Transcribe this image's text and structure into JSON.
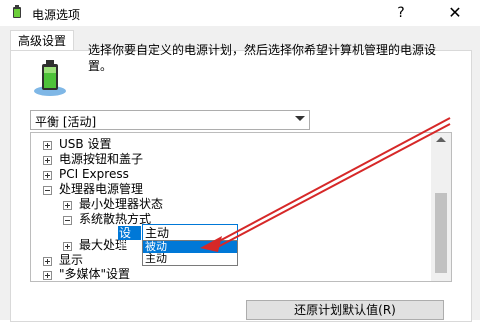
{
  "window": {
    "title": "电源选项",
    "help_label": "?",
    "close_label": "✕"
  },
  "tab": {
    "label": "高级设置"
  },
  "description": "选择你要自定义的电源计划，然后选择你希望计算机管理的电源设置。",
  "plan_select": {
    "value": "平衡 [活动]"
  },
  "tree": {
    "items": [
      {
        "label": "USB 设置",
        "expanded": false
      },
      {
        "label": "电源按钮和盖子",
        "expanded": false
      },
      {
        "label": "PCI Express",
        "expanded": false
      },
      {
        "label": "处理器电源管理",
        "expanded": true
      },
      {
        "label": "最小处理器状态",
        "expanded": false
      },
      {
        "label": "系统散热方式",
        "expanded": true
      },
      {
        "label": "最大处理",
        "expanded": false
      },
      {
        "label": "显示",
        "expanded": false
      },
      {
        "label": "\"多媒体\"设置",
        "expanded": false
      }
    ]
  },
  "setting": {
    "label": "设置:",
    "current_value": "主动",
    "options": [
      "被动",
      "主动"
    ],
    "highlighted_option": "被动"
  },
  "restore_button": {
    "label": "还原计划默认值(R)"
  },
  "icons": {
    "title": "battery-power-icon",
    "battery": "battery-plan-icon"
  },
  "colors": {
    "selection": "#0078d7",
    "annotation_arrow": "#d62828"
  }
}
